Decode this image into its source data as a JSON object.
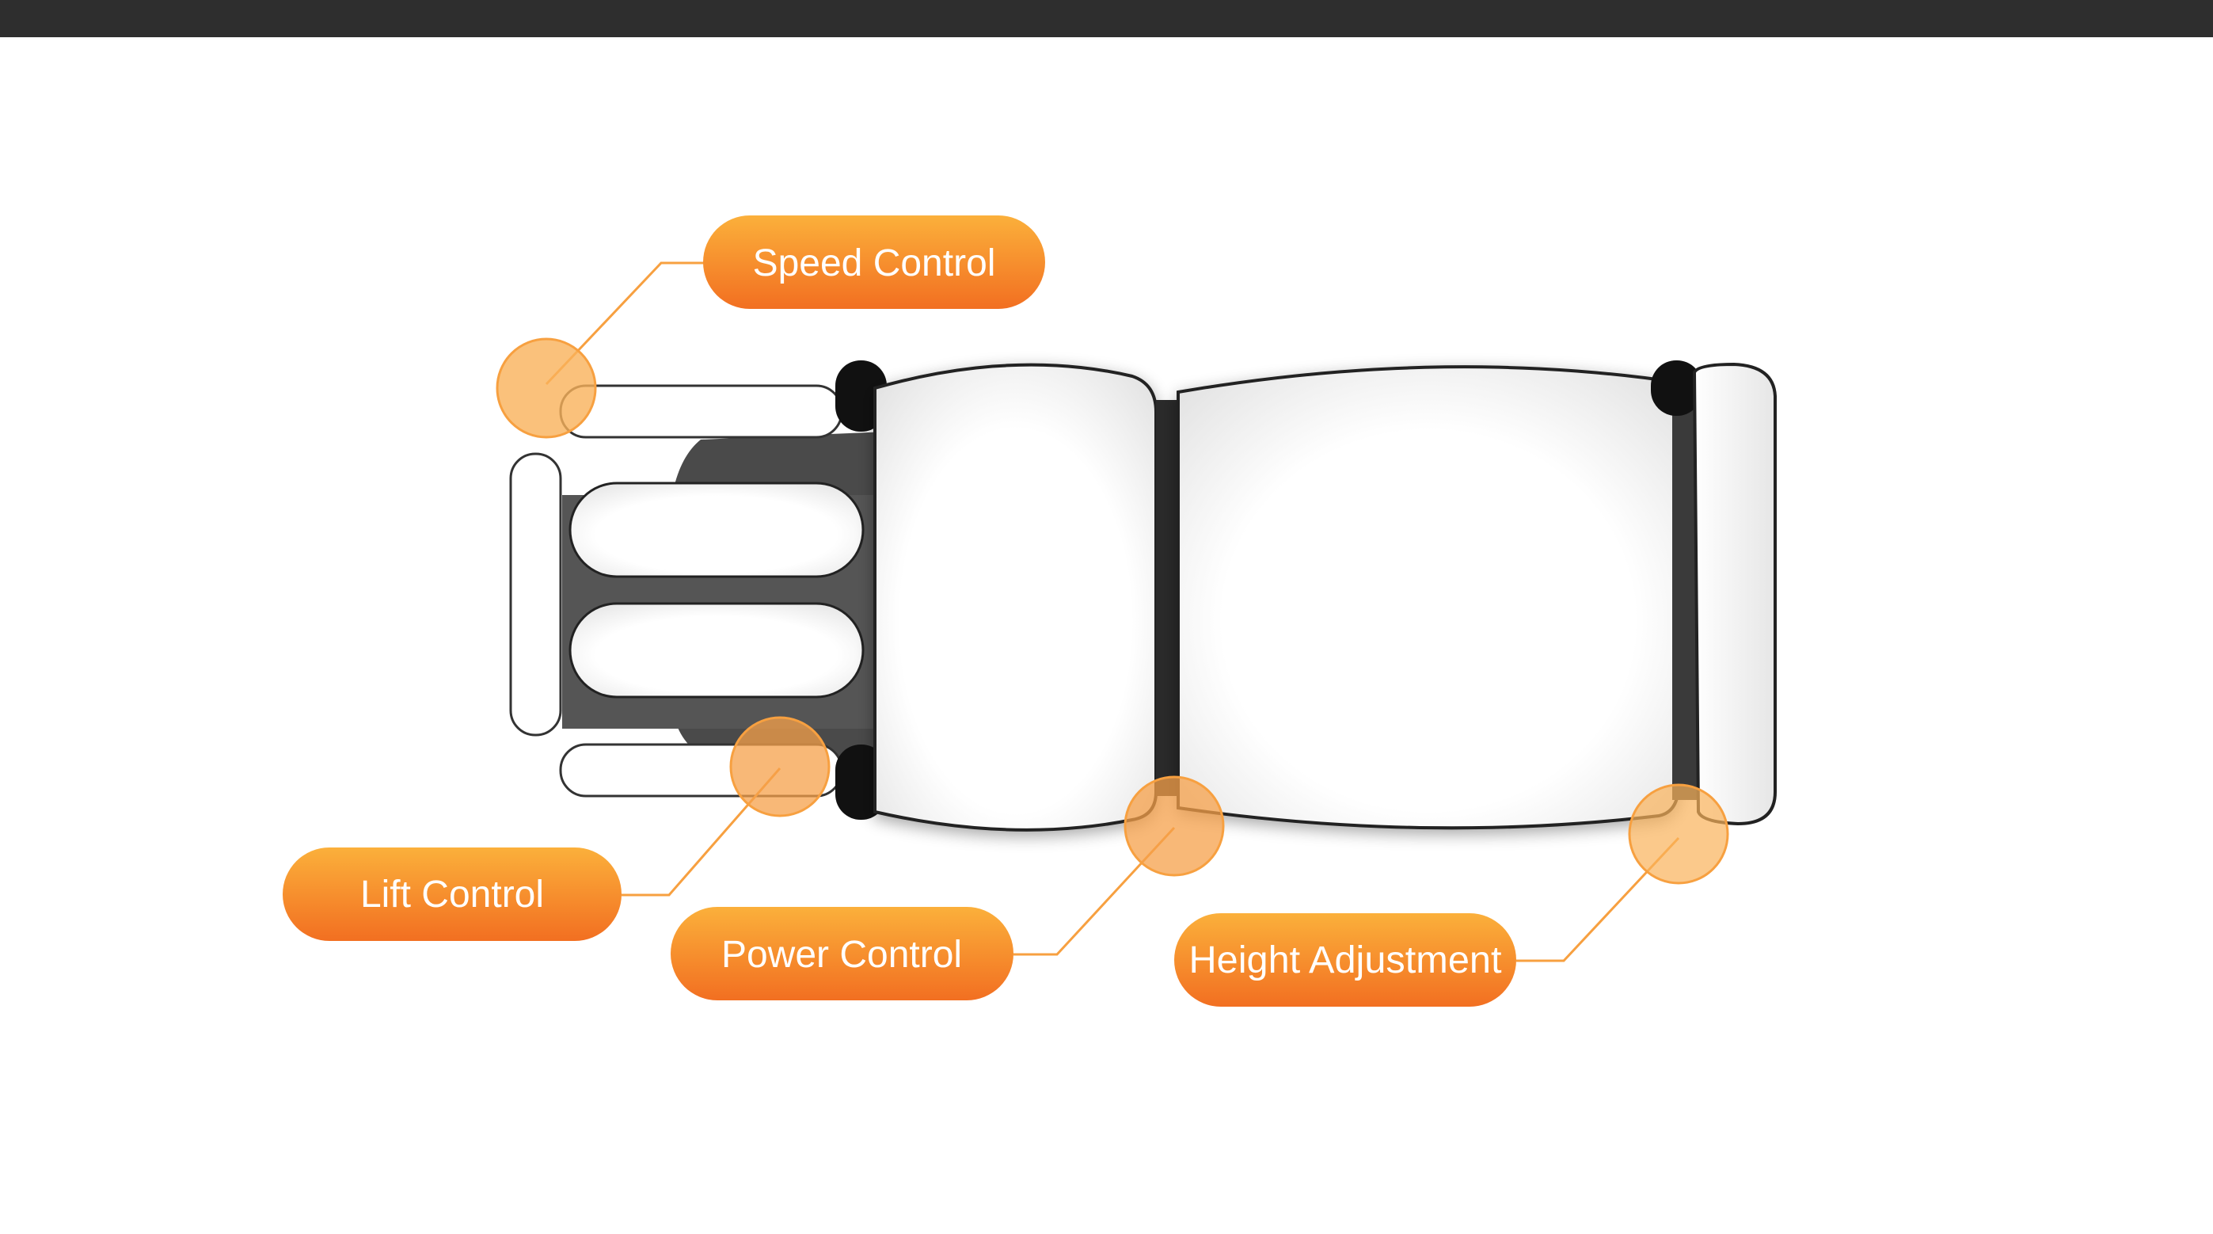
{
  "colors": {
    "top_bar": "#2e2e2e",
    "accent_orange": "#f58220",
    "accent_orange_light": "#fbb03b",
    "marker_fill": "#f9b25a",
    "leader_line": "#f7a040",
    "frame_dark": "#4a4a4a",
    "cushion_fill": "#ffffff",
    "outline": "#222222"
  },
  "callouts": {
    "speed_control": "Speed Control",
    "lift_control": "Lift Control",
    "power_control": "Power Control",
    "height_adjustment": "Height Adjustment"
  }
}
